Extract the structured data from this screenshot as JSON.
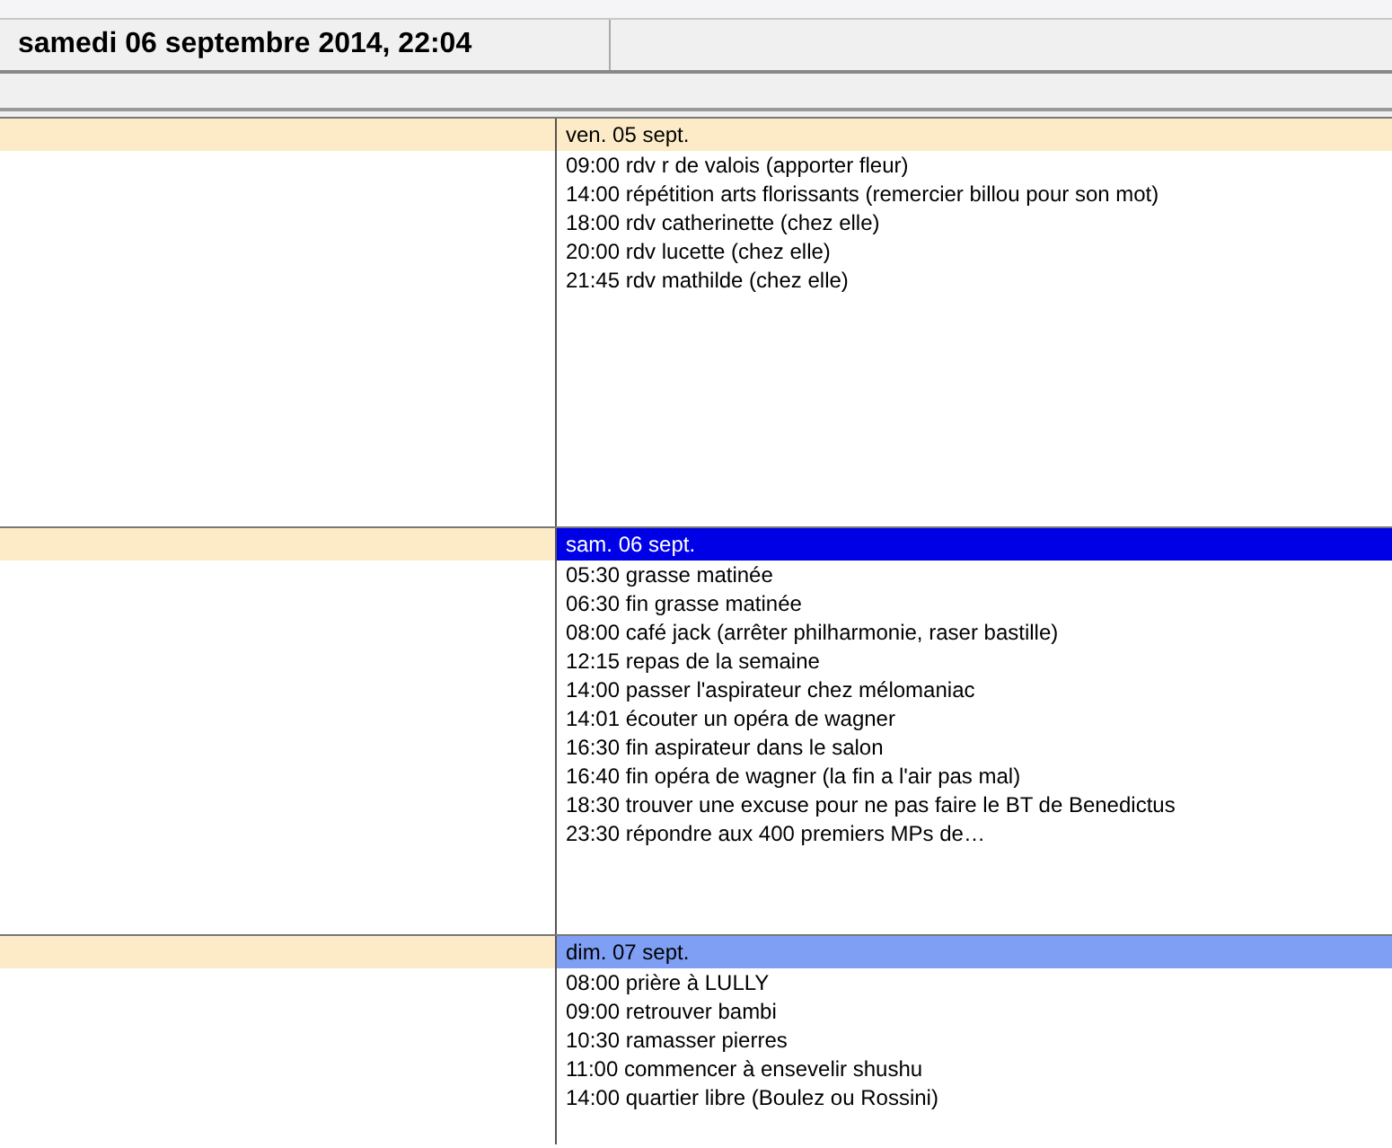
{
  "header": {
    "title": "samedi 06 septembre 2014, 22:04"
  },
  "days": [
    {
      "label": "ven. 05 sept.",
      "kind": "past",
      "events": [
        "09:00 rdv r de valois (apporter fleur)",
        "14:00 répétition arts florissants (remercier billou pour son mot)",
        "18:00 rdv catherinette (chez elle)",
        "20:00 rdv lucette (chez elle)",
        "21:45 rdv mathilde (chez elle)"
      ]
    },
    {
      "label": "sam. 06 sept.",
      "kind": "today",
      "events": [
        "05:30 grasse matinée",
        "06:30 fin grasse matinée",
        "08:00 café jack (arrêter philharmonie, raser bastille)",
        "12:15 repas de la semaine",
        "14:00 passer l'aspirateur chez mélomaniac",
        "14:01 écouter un opéra de wagner",
        "16:30 fin aspirateur dans le salon",
        "16:40 fin opéra de wagner (la fin a l'air pas mal)",
        "18:30 trouver une excuse pour ne pas faire le BT de Benedictus",
        "23:30 répondre aux 400 premiers MPs de…"
      ]
    },
    {
      "label": "dim. 07 sept.",
      "kind": "upcoming",
      "events": [
        "08:00 prière à LULLY",
        "09:00 retrouver bambi",
        "10:30 ramasser pierres",
        "11:00 commencer à ensevelir shushu",
        "14:00 quartier libre (Boulez ou Rossini)"
      ]
    }
  ]
}
